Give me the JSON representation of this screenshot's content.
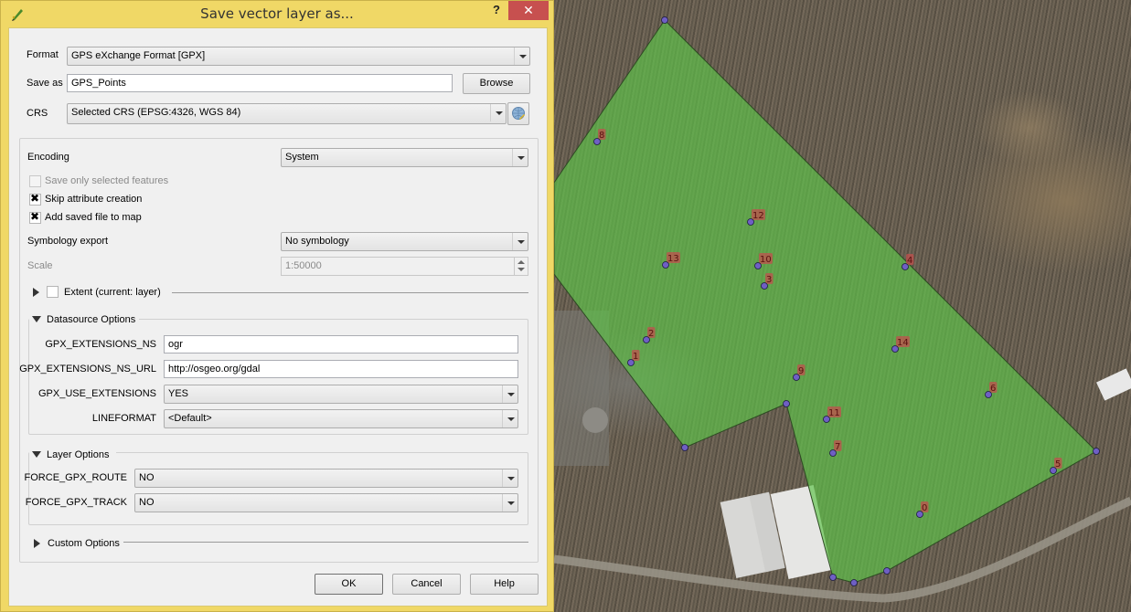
{
  "window": {
    "title": "Save vector layer as...",
    "help_label": "?",
    "close_label": "✕"
  },
  "form": {
    "format_label": "Format",
    "format_value": "GPS eXchange Format [GPX]",
    "save_as_label": "Save as",
    "save_as_value": "GPS_Points",
    "browse_label": "Browse",
    "crs_label": "CRS",
    "crs_value": "Selected CRS (EPSG:4326, WGS 84)",
    "crs_select_icon": "globe-icon"
  },
  "options": {
    "encoding_label": "Encoding",
    "encoding_value": "System",
    "save_selected_label": "Save only selected features",
    "save_selected_checked": false,
    "save_selected_enabled": false,
    "skip_attr_label": "Skip attribute creation",
    "skip_attr_checked": true,
    "add_to_map_label": "Add saved file to map",
    "add_to_map_checked": true,
    "symbology_label": "Symbology export",
    "symbology_value": "No symbology",
    "scale_label": "Scale",
    "scale_value": "1:50000",
    "extent_label": "Extent (current: layer)",
    "extent_checked": false
  },
  "datasource": {
    "title": "Datasource Options",
    "fields": [
      {
        "label": "GPX_EXTENSIONS_NS",
        "value": "ogr",
        "kind": "text"
      },
      {
        "label": "GPX_EXTENSIONS_NS_URL",
        "value": "http://osgeo.org/gdal",
        "kind": "text"
      },
      {
        "label": "GPX_USE_EXTENSIONS",
        "value": "YES",
        "kind": "select"
      },
      {
        "label": "LINEFORMAT",
        "value": "<Default>",
        "kind": "select"
      }
    ]
  },
  "layer": {
    "title": "Layer Options",
    "fields": [
      {
        "label": "FORCE_GPX_ROUTE",
        "value": "NO"
      },
      {
        "label": "FORCE_GPX_TRACK",
        "value": "NO"
      }
    ]
  },
  "custom": {
    "title": "Custom Options"
  },
  "buttons": {
    "ok": "OK",
    "cancel": "Cancel",
    "help": "Help"
  },
  "map": {
    "polygon_fill": "#5fc24a",
    "point_color": "#6f5fc4",
    "label_halo": "#c0504d",
    "points": [
      {
        "label": "0"
      },
      {
        "label": "1"
      },
      {
        "label": "2"
      },
      {
        "label": "3"
      },
      {
        "label": "4"
      },
      {
        "label": "5"
      },
      {
        "label": "6"
      },
      {
        "label": "7"
      },
      {
        "label": "8"
      },
      {
        "label": "9"
      },
      {
        "label": "10"
      },
      {
        "label": "11"
      },
      {
        "label": "12"
      },
      {
        "label": "13"
      },
      {
        "label": "14"
      }
    ]
  }
}
